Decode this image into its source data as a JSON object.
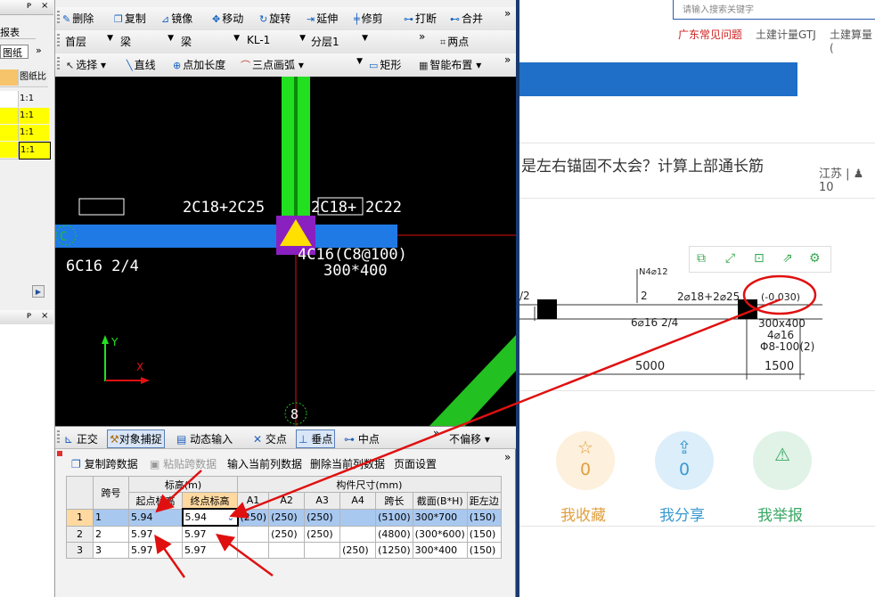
{
  "left_panel": {
    "top_tab": "报表",
    "tool_button": "图纸",
    "column_header": "图纸比",
    "rows": [
      "1:1",
      "1:1",
      "1:1",
      "1:1"
    ],
    "pin_glyph": "ᴘ",
    "close_glyph": "×",
    "more_glyph": "»",
    "scroll_right": "▶"
  },
  "toolbar1": {
    "items": [
      "删除",
      "复制",
      "镜像",
      "移动",
      "旋转",
      "延伸",
      "修剪",
      "打断",
      "合并"
    ]
  },
  "toolbar2": {
    "floor": "首层",
    "type1": "梁",
    "type2": "梁",
    "component": "KL-1",
    "layer": "分层1",
    "two_point": "两点"
  },
  "toolbar3": {
    "select": "选择",
    "line": "直线",
    "point_len": "点加长度",
    "three_arc": "三点画弧",
    "rect": "矩形",
    "smart_layout": "智能布置"
  },
  "canvas": {
    "label_left_top": "2C18+2C25",
    "label_right_top_a": "2C18+",
    "label_right_top_b": "2C22",
    "label_bottom_left": "6C16 2/4",
    "label_stirrup": "4C16(C8@100)",
    "label_section": "300*400",
    "axis_c": "C",
    "axis_8": "8",
    "axis_y": "Y",
    "axis_x": "X"
  },
  "snap_bar": {
    "ortho": "正交",
    "snap": "对象捕捉",
    "dyn": "动态输入",
    "intersect": "交点",
    "perp": "垂点",
    "mid": "中点",
    "offset": "不偏移"
  },
  "table_toolbar": {
    "copy": "复制跨数据",
    "paste": "粘贴跨数据",
    "input_col": "输入当前列数据",
    "delete_col": "删除当前列数据",
    "page_setup": "页面设置"
  },
  "span_table": {
    "header_span": "跨号",
    "header_elev": "标高(m)",
    "header_size": "构件尺寸(mm)",
    "cols": [
      "起点标高",
      "终点标高",
      "A1",
      "A2",
      "A3",
      "A4",
      "跨长",
      "截面(B*H)",
      "距左边"
    ],
    "rows": [
      {
        "rn": "1",
        "span": "1",
        "start": "5.94",
        "end": "5.94",
        "a1": "(250)",
        "a2": "(250)",
        "a3": "(250)",
        "a4": "",
        "len": "(5100)",
        "sec": "300*700",
        "dist": "(150)"
      },
      {
        "rn": "2",
        "span": "2",
        "start": "5.97",
        "end": "5.97",
        "a1": "",
        "a2": "(250)",
        "a3": "(250)",
        "a4": "",
        "len": "(4800)",
        "sec": "(300*600)",
        "dist": "(150)"
      },
      {
        "rn": "3",
        "span": "3",
        "start": "5.97",
        "end": "5.97",
        "a1": "",
        "a2": "",
        "a3": "",
        "a4": "(250)",
        "len": "(1250)",
        "sec": "300*400",
        "dist": "(150)"
      }
    ]
  },
  "web": {
    "search_hint": "请输入搜索关键字",
    "nav": [
      "广东常见问题",
      "土建计量GTJ",
      "土建算量("
    ],
    "title": "是左右锚固不太会？计算上部通长筋",
    "meta": "江苏 | ♟ 10",
    "drawing": {
      "top_small": "N4⌀12",
      "label_2": "2",
      "label_slash2": "/2",
      "top_rebar": "2⌀18+2⌀25",
      "elev": "(-0.030)",
      "bottom_rebar": "6⌀16 2/4",
      "sec": "300x400",
      "rebar2": "4⌀16",
      "stirrup": "Φ8-100(2)",
      "dim1": "5000",
      "dim2": "1500"
    },
    "actions": [
      {
        "count": "0",
        "label": "我收藏",
        "color": "#e0a040",
        "bg": "#fdf0dc"
      },
      {
        "count": "0",
        "label": "我分享",
        "color": "#3a9ad0",
        "bg": "#dceefa"
      },
      {
        "count": "",
        "label": "我举报",
        "color": "#3aa865",
        "bg": "#e0f3e6"
      }
    ]
  },
  "colors": {
    "annotation_red": "#e01010",
    "beam_blue": "#1f7ae6",
    "column_green": "#22e020"
  }
}
